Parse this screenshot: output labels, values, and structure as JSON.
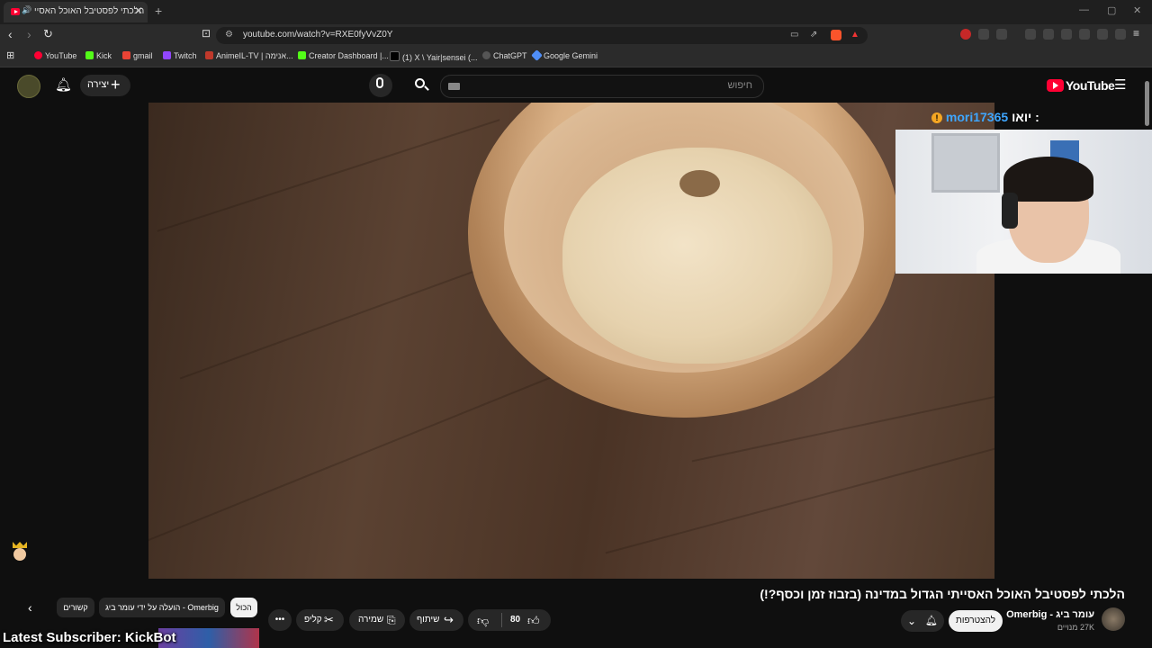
{
  "browser": {
    "tab_title": "הלכתי לפסטיבל האוכל האסיי",
    "url": "youtube.com/watch?v=RXE0fyVvZ0Y",
    "bookmarks": [
      {
        "label": "YouTube",
        "color": "#ff0033"
      },
      {
        "label": "Kick",
        "color": "#53fc18"
      },
      {
        "label": "gmail",
        "color": "#ea4335"
      },
      {
        "label": "Twitch",
        "color": "#9146ff"
      },
      {
        "label": "AnimeIL-TV | אנימה...",
        "color": "#c0392b"
      },
      {
        "label": "Creator Dashboard |...",
        "color": "#53fc18"
      },
      {
        "label": "(1) X \\ Yair|sensei (...",
        "color": "#000000"
      },
      {
        "label": "ChatGPT",
        "color": "#555555"
      },
      {
        "label": "Google Gemini",
        "color": "#4f8ef7"
      }
    ]
  },
  "youtube": {
    "logo": "YouTube",
    "search_placeholder": "חיפוש",
    "create_label": "יצירה"
  },
  "overlay": {
    "chat_user": "mori17365",
    "chat_text": "יואו :",
    "latest_subscriber": "Latest Subscriber: KickBot"
  },
  "video": {
    "title": "הלכתי לפסטיבל האוכל האסייתי הגדול במדינה (בזבוז זמן וכסף?!)",
    "channel_name": "עומר ביג - Omerbig",
    "subscribers": "27K מנויים",
    "subscribe_label": "להצטרפות",
    "likes": "80",
    "share_label": "שיתוף",
    "save_label": "שמירה",
    "clip_label": "קליפ"
  },
  "chips": {
    "all": "הכול",
    "uploaded_by": "הועלה על ידי עומר ביג - Omerbig",
    "related": "קשורים"
  },
  "colors": {
    "accent": "#ff0033",
    "link": "#3ea6ff"
  }
}
